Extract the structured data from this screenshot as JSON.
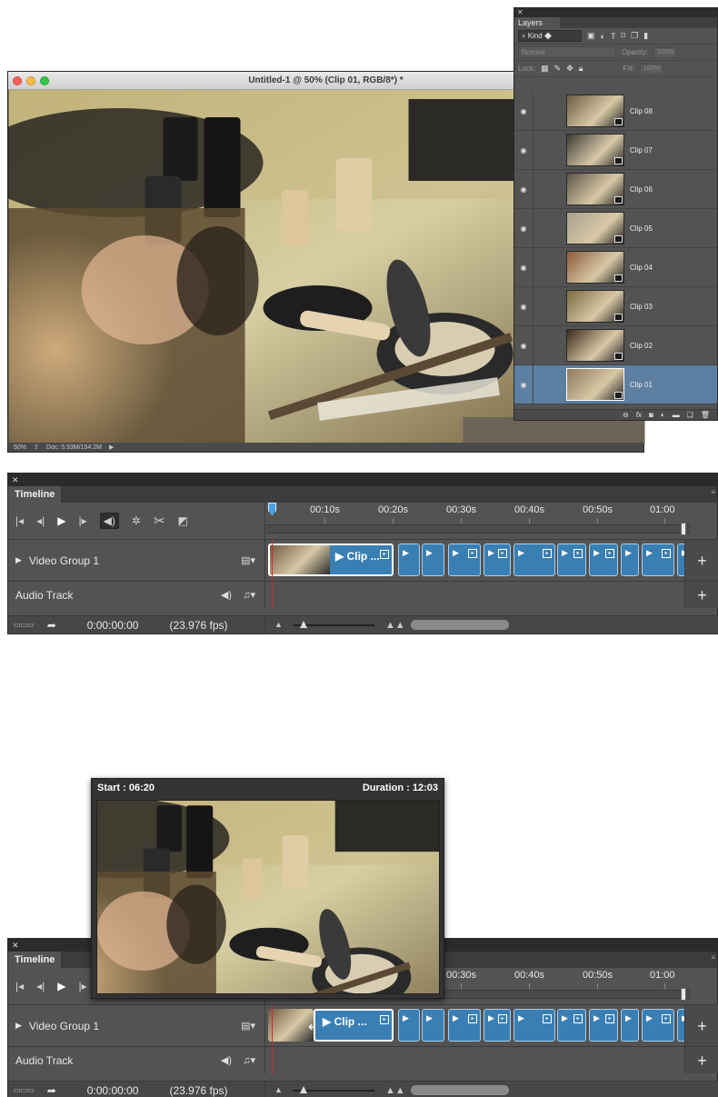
{
  "document_window": {
    "title": "Untitled-1 @ 50% (Clip 01, RGB/8*) *",
    "status": {
      "zoom": "50%",
      "doc_size": "Doc: 5.93M/154.2M"
    }
  },
  "layers_panel": {
    "tab": "Layers",
    "filter_kind": "Kind",
    "blend_mode": "Normal",
    "opacity_label": "Opacity:",
    "opacity_value": "100%",
    "lock_label": "Lock:",
    "fill_label": "Fill:",
    "fill_value": "100%",
    "layers": [
      {
        "name": "Clip 08",
        "selected": false
      },
      {
        "name": "Clip 07",
        "selected": false
      },
      {
        "name": "Clip 06",
        "selected": false
      },
      {
        "name": "Clip 05",
        "selected": false
      },
      {
        "name": "Clip 04",
        "selected": false
      },
      {
        "name": "Clip 03",
        "selected": false
      },
      {
        "name": "Clip 02",
        "selected": false
      },
      {
        "name": "Clip 01",
        "selected": true
      }
    ],
    "footer_icons": [
      "link-icon",
      "fx-icon",
      "mask-icon",
      "adjustment-icon",
      "folder-icon",
      "new-layer-icon",
      "trash-icon"
    ]
  },
  "timeline": {
    "tab": "Timeline",
    "ruler_ticks": [
      "00:10s",
      "00:20s",
      "00:30s",
      "00:40s",
      "00:50s",
      "01:00"
    ],
    "video_track": "Video Group 1",
    "audio_track": "Audio Track",
    "first_clip_name": "Clip ...",
    "timecode": "0:00:00:00",
    "fps": "(23.976 fps)",
    "add_label": "+"
  },
  "hover_preview": {
    "start": "Start : 06:20",
    "duration": "Duration : 12:03"
  },
  "colors": {
    "panel": "#535353",
    "clip_blue": "#3a7fb4",
    "selection_blue": "#5d7fa2",
    "playhead_blue": "#4aa1e0",
    "playhead_line": "#d42a2a"
  }
}
